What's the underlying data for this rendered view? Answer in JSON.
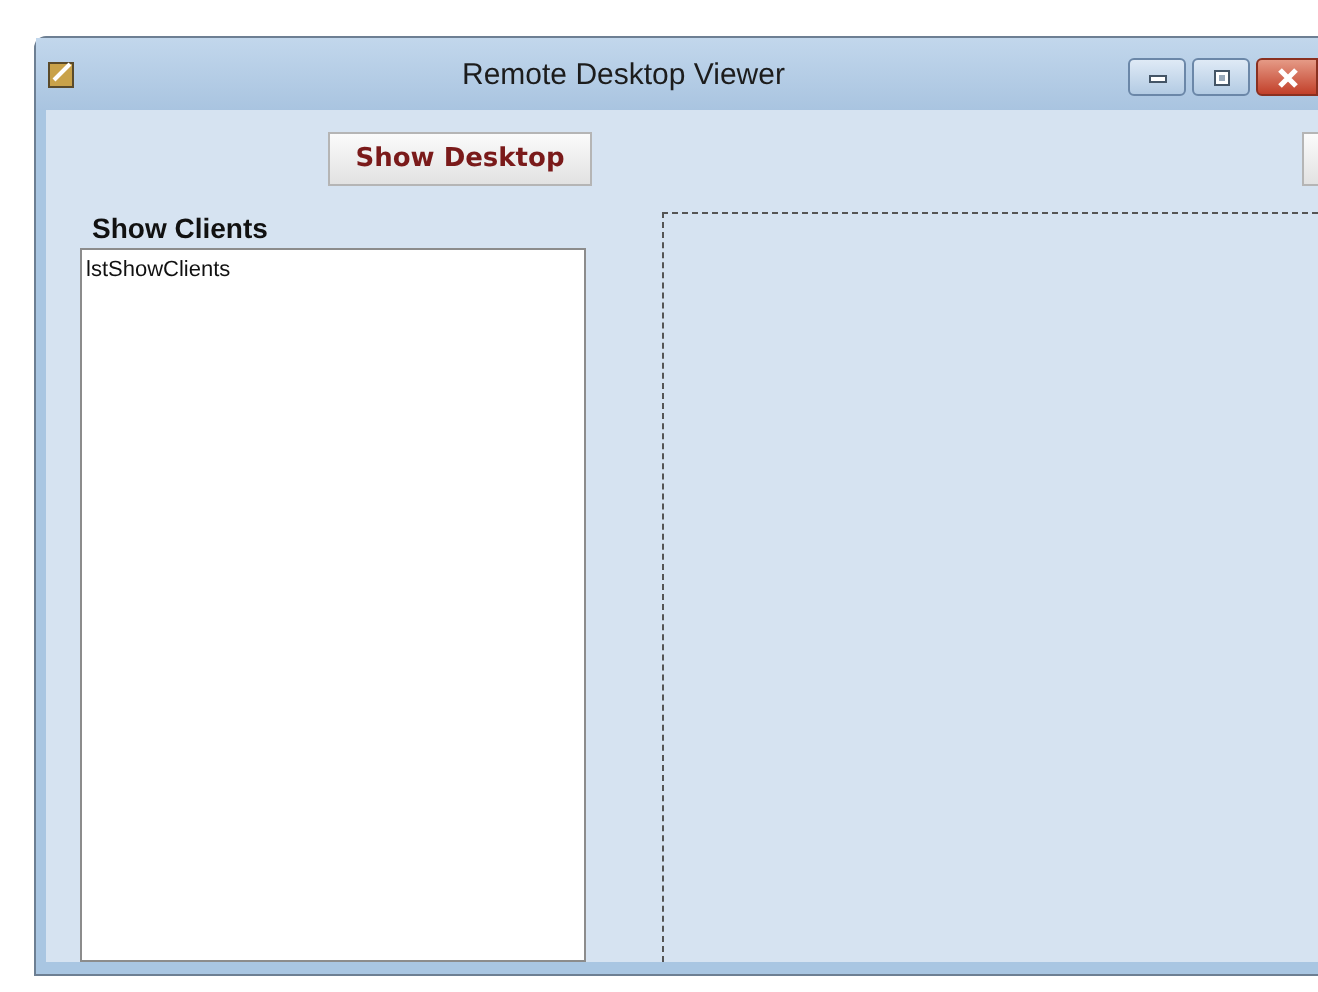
{
  "window": {
    "title": "Remote Desktop Viewer"
  },
  "toolbar": {
    "buttons": [
      {
        "label": "Show Desktop",
        "kind": "text"
      },
      {
        "kind": "edge"
      }
    ]
  },
  "clients": {
    "label": "Show Clients",
    "items": [
      {
        "label": "lstShowClients",
        "selected": false
      }
    ]
  }
}
